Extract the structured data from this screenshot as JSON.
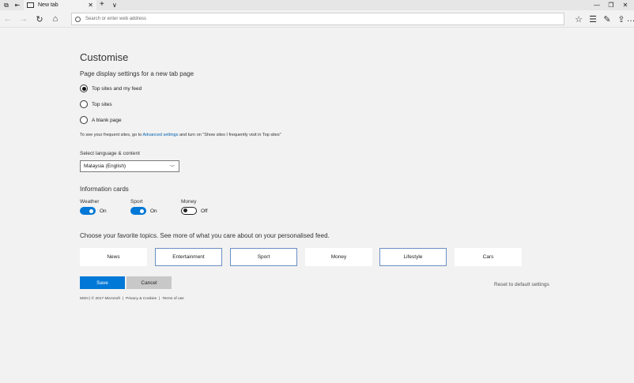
{
  "tab": {
    "title": "New tab"
  },
  "address_bar": {
    "placeholder": "Search or enter web address"
  },
  "main": {
    "title": "Customise",
    "display_heading": "Page display settings for a new tab page",
    "radio_options": [
      {
        "label": "Top sites and my feed",
        "selected": true
      },
      {
        "label": "Top sites",
        "selected": false
      },
      {
        "label": "A blank page",
        "selected": false
      }
    ],
    "note_prefix": "To see your frequent sites, go to ",
    "note_link": "Advanced settings",
    "note_suffix": " and turn on \"Show sites I frequently visit in Top sites\"",
    "language_label": "Select language & content",
    "language_value": "Malaysia (English)",
    "cards_heading": "Information cards",
    "cards": [
      {
        "label": "Weather",
        "state": "On",
        "on": true
      },
      {
        "label": "Sport",
        "state": "On",
        "on": true
      },
      {
        "label": "Money",
        "state": "Off",
        "on": false
      }
    ],
    "topics_heading": "Choose your favorite topics. See more of what you care about on your personalised feed.",
    "topics": [
      {
        "label": "News",
        "selected": false
      },
      {
        "label": "Entertainment",
        "selected": true
      },
      {
        "label": "Sport",
        "selected": true
      },
      {
        "label": "Money",
        "selected": false
      },
      {
        "label": "Lifestyle",
        "selected": true
      },
      {
        "label": "Cars",
        "selected": false
      }
    ],
    "save_label": "Save",
    "cancel_label": "Cancel",
    "reset_label": "Reset to default settings"
  },
  "footer": {
    "copyright": "MSN | © 2017 Microsoft",
    "privacy": "Privacy & Cookies",
    "terms": "Terms of use"
  },
  "colors": {
    "accent": "#0078d7",
    "link": "#0063b1"
  }
}
